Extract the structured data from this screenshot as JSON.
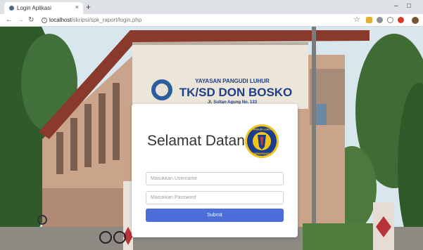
{
  "browser": {
    "tab_title": "Login Aplikasi",
    "tab_close": "×",
    "new_tab": "+",
    "window_minimize": "–",
    "window_maximize": "□",
    "url_host": "localhost",
    "url_path": "/skripsi/spk_raport/login.php",
    "icons": [
      "back-arrow-icon",
      "forward-arrow-icon",
      "reload-icon",
      "info-icon",
      "star-icon",
      "extension-icon",
      "profile-avatar-icon"
    ]
  },
  "background": {
    "sign_line1": "YAYASAN PANGUDI LUHUR",
    "sign_line2": "TK/SD DON BOSKO",
    "sign_line3": "Jl. Sultan Agung No. 133"
  },
  "login": {
    "title": "Selamat Datang",
    "username_placeholder": "Masukkan Username",
    "password_placeholder": "Masukkan Password",
    "submit_label": "Submit",
    "logo_text_top": "PANGUDI LUHUR",
    "logo_text_bottom": "SEMARANG"
  },
  "colors": {
    "submit_button": "#4c6ed8",
    "logo_ring": "#1a3d8f",
    "logo_fill": "#f2c418"
  }
}
